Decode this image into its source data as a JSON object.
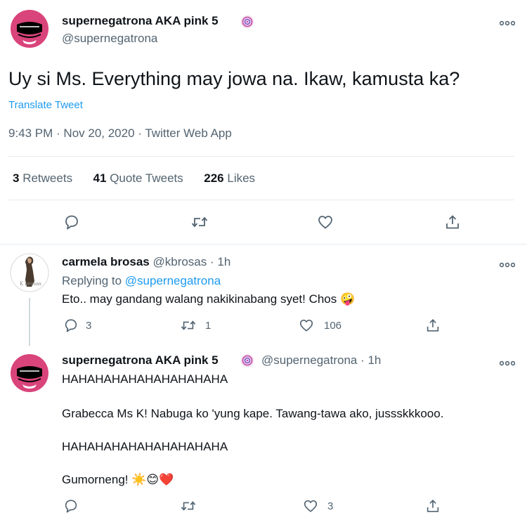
{
  "main_tweet": {
    "display_name": "supernegatrona AKA pink 5",
    "handle": "@supernegatrona",
    "text": "Uy si Ms. Everything may jowa na. Ikaw, kamusta ka?",
    "translate_label": "Translate Tweet",
    "timestamp": "9:43 PM · Nov 20, 2020 · Twitter Web App",
    "stats": {
      "retweets_num": "3",
      "retweets_label": "Retweets",
      "quotes_num": "41",
      "quotes_label": "Quote Tweets",
      "likes_num": "226",
      "likes_label": "Likes"
    }
  },
  "reply1": {
    "display_name": "carmela brosas",
    "handle_time": "@kbrosas · 1h",
    "replying_prefix": "Replying to",
    "replying_handle": "@supernegatrona",
    "text": "Eto.. may gandang walang nakikinabang syet! Chos",
    "emoji": "🤪",
    "counts": {
      "replies": "3",
      "retweets": "1",
      "likes": "106"
    },
    "avatar_text": "K brosas"
  },
  "reply2": {
    "display_name": "supernegatrona AKA pink 5",
    "handle_time": "@supernegatrona · 1h",
    "lines": [
      "HAHAHAHAHAHAHAHAHAHA",
      "Grabecca Ms K! Nabuga ko 'yung kape. Tawang-tawa ako, jussskkkooo.",
      "HAHAHAHAHAHAHAHAHAHA",
      "Gumorneng!"
    ],
    "emojis": "☀️😊❤️",
    "counts": {
      "likes": "3"
    }
  },
  "icons": {
    "more": "more-icon",
    "badge": "swirl-badge-icon",
    "reply": "reply-icon",
    "retweet": "retweet-icon",
    "like": "heart-icon",
    "share": "share-icon"
  },
  "colors": {
    "link": "#1d9bf0",
    "secondary_text": "#536471",
    "divider": "#e6ecf0",
    "avatar_pink": "#d9447a"
  }
}
